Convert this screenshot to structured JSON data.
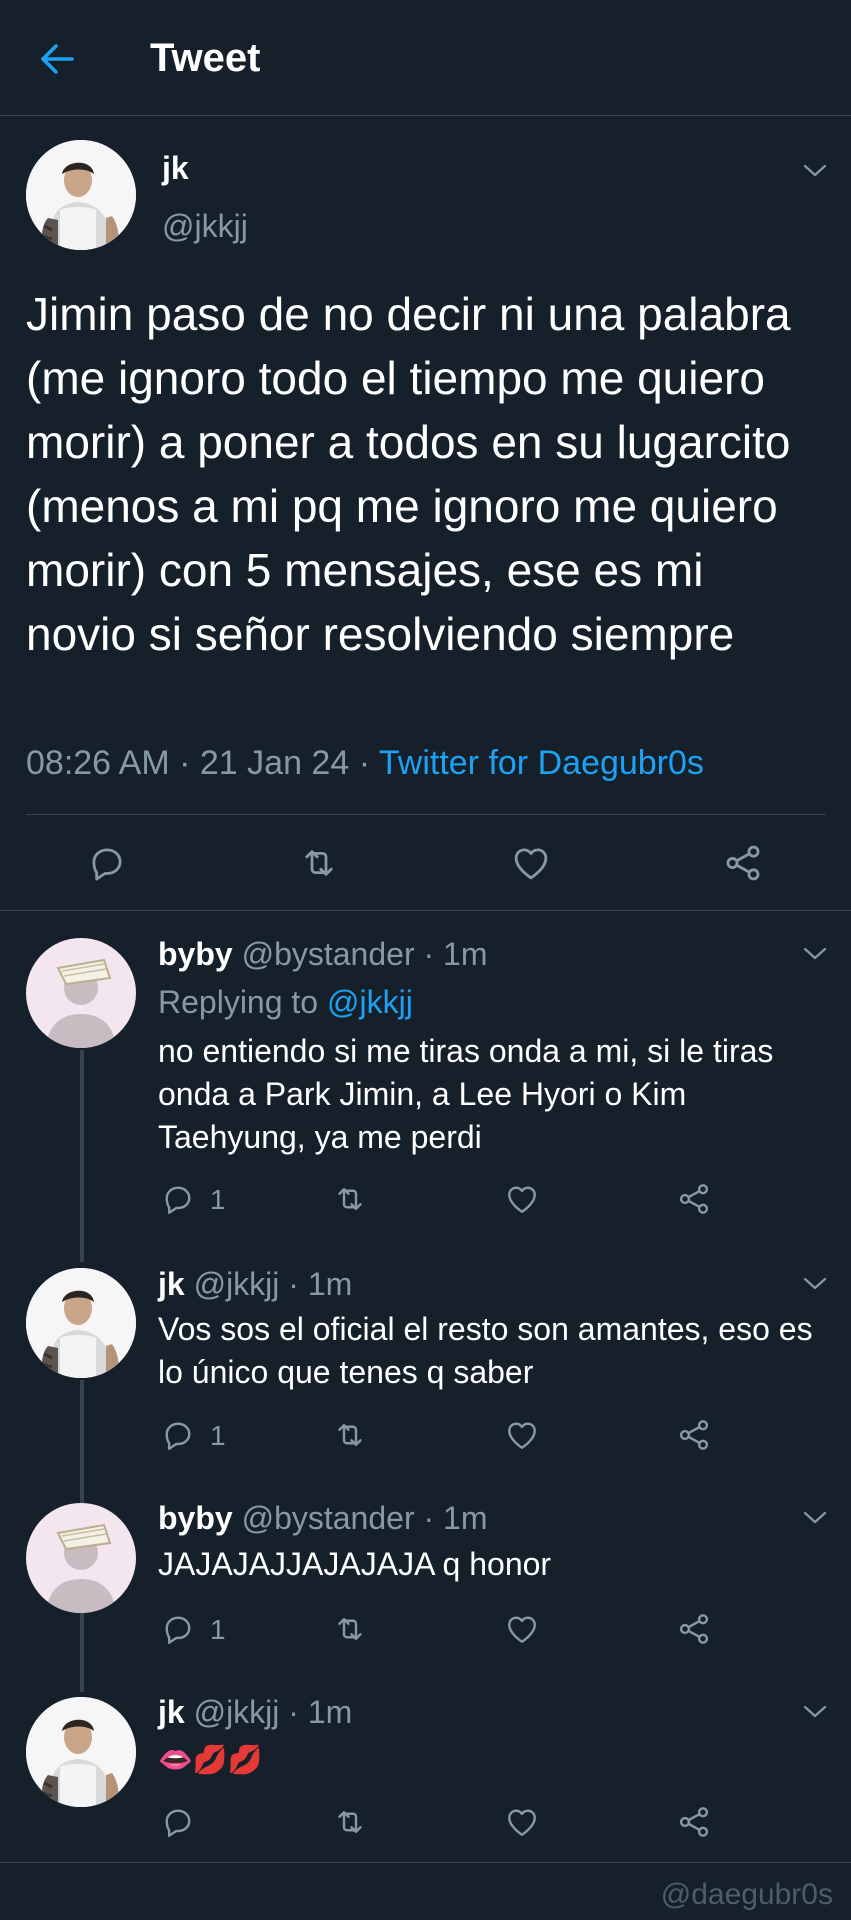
{
  "header": {
    "title": "Tweet",
    "back_icon": "arrow-left-icon"
  },
  "colors": {
    "background": "#15202b",
    "accent": "#1da1f2",
    "muted": "#8899a6",
    "divider": "#38444d"
  },
  "main_tweet": {
    "name": "jk",
    "handle": "@jkkjj",
    "text": "Jimin paso de no decir ni una palabra (me ignoro todo el tiempo me quiero morir) a poner a todos en su lugarcito (menos a mi pq me ignoro me quiero morir) con 5 mensajes, ese es mi novio si señor resolviendo siempre",
    "time": "08:26 AM",
    "date": "21 Jan 24",
    "source": "Twitter for Daegubr0s",
    "sep": "·"
  },
  "replies": [
    {
      "name": "byby",
      "handle": "@bystander",
      "time": "1m",
      "replying_label": "Replying to",
      "replying_to": "@jkkjj",
      "text": "no entiendo si me tiras onda a mi, si le tiras onda a Park Jimin, a Lee Hyori o Kim Taehyung, ya me perdi",
      "reply_count": "1"
    },
    {
      "name": "jk",
      "handle": "@jkkjj",
      "time": "1m",
      "text": "Vos sos el oficial el resto son amantes, eso es lo único que tenes q saber",
      "reply_count": "1"
    },
    {
      "name": "byby",
      "handle": "@bystander",
      "time": "1m",
      "text": "JAJAJAJJAJAJAJA q honor",
      "reply_count": "1"
    },
    {
      "name": "jk",
      "handle": "@jkkjj",
      "time": "1m",
      "text": "👄💋💋",
      "reply_count": ""
    }
  ],
  "watermark": "@daegubr0s"
}
